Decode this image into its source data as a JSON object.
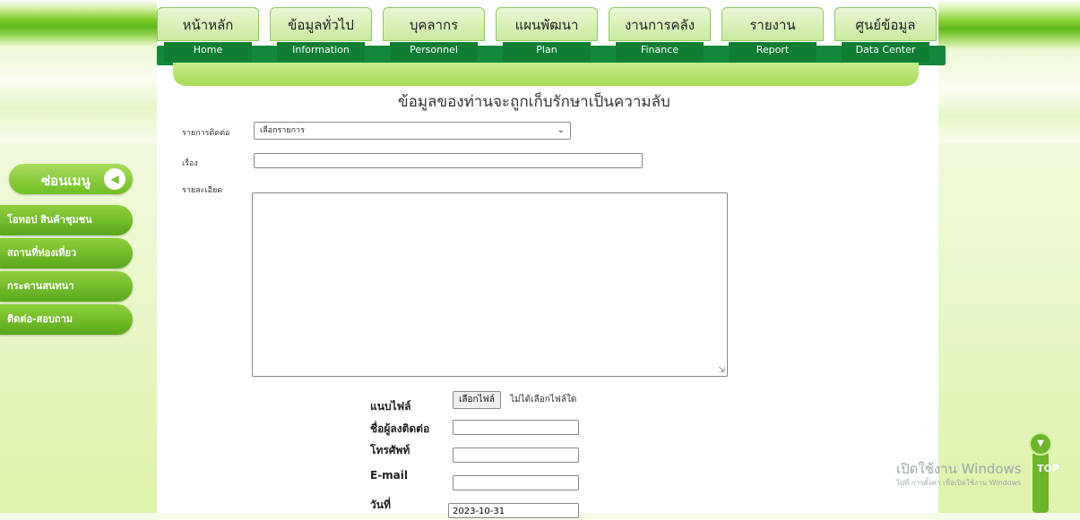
{
  "nav": {
    "items": [
      {
        "thai": "หน้าหลัก",
        "en": "Home"
      },
      {
        "thai": "ข้อมูลทั่วไป",
        "en": "Information"
      },
      {
        "thai": "บุคลากร",
        "en": "Personnel"
      },
      {
        "thai": "แผนพัฒนา",
        "en": "Plan"
      },
      {
        "thai": "งานการคลัง",
        "en": "Finance"
      },
      {
        "thai": "รายงาน",
        "en": "Report"
      },
      {
        "thai": "ศูนย์ข้อมูล",
        "en": "Data Center"
      }
    ]
  },
  "form": {
    "title": "ข้อมูลของท่านจะถูกเก็บรักษาเป็นความลับ",
    "contact_type_label": "รายการติดต่อ",
    "contact_type_value": "เลือกรายการ",
    "subject_label": "เรื่อง",
    "detail_label": "รายละเอียด",
    "attach_label": "แนบไฟล์",
    "file_button": "เลือกไฟล์",
    "file_none": "ไม่ได้เลือกไฟล์ใด",
    "contact_name_label": "ชื่อผู้ลงติดต่อ",
    "phone_label": "โทรศัพท์",
    "email_label": "E-mail",
    "date_label": "วันที่",
    "date_value": "2023-10-31"
  },
  "sidebar": {
    "toggle_label": "ซ่อนเมนู",
    "items": [
      {
        "label": "โอทอป สินค้าชุมชน"
      },
      {
        "label": "สถานที่ท่องเที่ยว"
      },
      {
        "label": "กระดานสนทนา"
      },
      {
        "label": "ติดต่อ-สอบถาม"
      }
    ]
  },
  "watermark": {
    "line1": "เปิดใช้งาน Windows",
    "line2": "ไปที่ การตั้งค่า เพื่อเปิดใช้งาน Windows"
  },
  "top_button": {
    "label": "TOP"
  }
}
